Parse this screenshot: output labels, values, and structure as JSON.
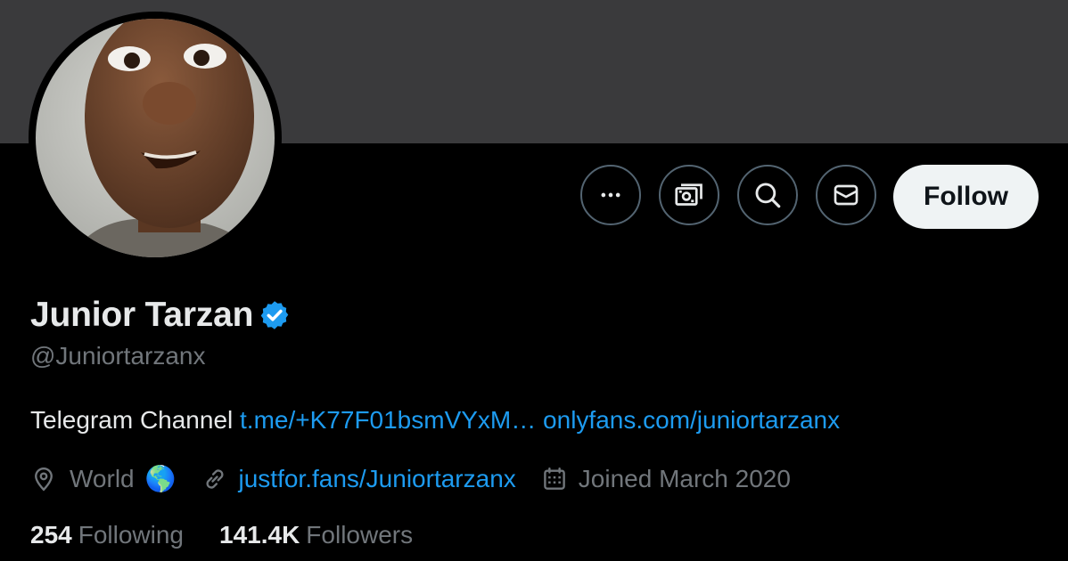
{
  "profile": {
    "display_name": "Junior Tarzan",
    "handle": "@Juniortarzanx",
    "verified": true
  },
  "actions": {
    "more_icon": "more-dots-icon",
    "tip_icon": "money-icon",
    "search_icon": "search-icon",
    "message_icon": "mail-icon",
    "follow_label": "Follow"
  },
  "bio": {
    "text": "Telegram Channel",
    "link1": "t.me/+K77F01bsmVYxM…",
    "link2": "onlyfans.com/juniortarzanx"
  },
  "meta": {
    "location": "World",
    "location_emoji": "🌎",
    "website": "justfor.fans/Juniortarzanx",
    "joined": "Joined March 2020"
  },
  "stats": {
    "following_count": "254",
    "following_label": "Following",
    "followers_count": "141.4K",
    "followers_label": "Followers"
  },
  "colors": {
    "background": "#000000",
    "banner": "#3a3a3c",
    "link": "#1d9bf0",
    "muted": "#71767b",
    "follow_bg": "#eff3f4"
  }
}
